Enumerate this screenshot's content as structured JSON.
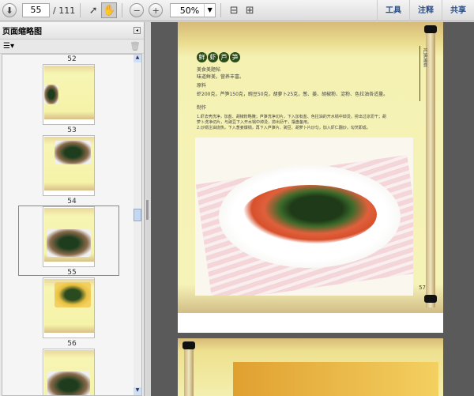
{
  "toolbar": {
    "current_page": "55",
    "total_pages": "/ 111",
    "zoom": "50%",
    "links": [
      "工具",
      "注释",
      "共享"
    ]
  },
  "sidebar": {
    "title": "页面缩略图",
    "thumbnails": [
      {
        "label": "52"
      },
      {
        "label": "53"
      },
      {
        "label": "54"
      },
      {
        "label": "55"
      },
      {
        "label": "56"
      }
    ],
    "selected_page": "55"
  },
  "page": {
    "title_chars": [
      "鲜",
      "虾",
      "芦",
      "笋"
    ],
    "subtitle": "美食美题帖",
    "tagline": "味道鲜美，营养丰富。",
    "ingredients_heading": "原料",
    "ingredients": "虾200克，芦笋150克，豌豆50克，胡萝卜25克，葱、姜、胡椒粉、淀粉、色拉油各适量。",
    "method_heading": "制作",
    "steps": [
      "1.虾去壳洗净，加盐、胡椒粉略腌；芦笋洗净切片，下入加有盐、色拉油的开水锅中焯烫，捞出过凉沥干；胡",
      "萝卜洗净切片，与豌豆下入开水锅中焯烫，捞出沥干，摆盘备用。",
      "2.炒锅注油烧热，下入葱姜爆锅，再下入芦笋片、豌豆、胡萝卜片炒匀，加入虾仁翻炒，勾芡即成。"
    ],
    "side_label": "芦笋美食",
    "page_number": "57"
  }
}
